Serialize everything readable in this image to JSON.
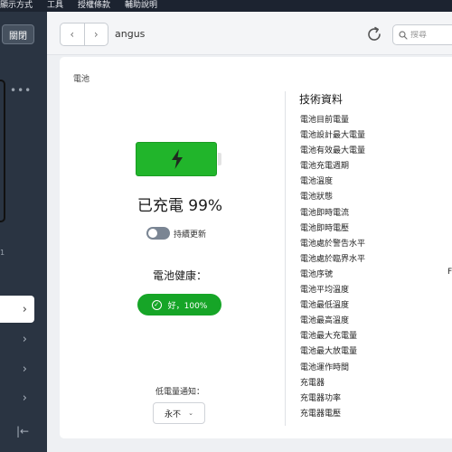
{
  "menu": [
    "顯示方式",
    "工具",
    "授權條款",
    "輔助說明"
  ],
  "sidebar": {
    "close_label": "關閉",
    "more_label": "•••",
    "number_label": "1",
    "items": [
      "›",
      "›",
      "›",
      "›"
    ],
    "collapse_label": "|←"
  },
  "toolbar": {
    "back": "‹",
    "forward": "›",
    "device_name": "angus",
    "search_placeholder": "搜尋"
  },
  "card": {
    "title": "電池",
    "battery": {
      "charged_text": "已充電 99%",
      "charge_level": 0.99,
      "auto_update_label": "持續更新",
      "auto_update_on": false,
      "health_label": "電池健康：",
      "health_value": "好，100%",
      "notify_label": "低電量通知：",
      "notify_value": "永不",
      "notify_chevron": "⌄",
      "check_glyph": "✓"
    },
    "specs": {
      "title": "技術資料",
      "items": [
        "電池目前電量",
        "電池設計最大電量",
        "電池有效最大電量",
        "電池充電週期",
        "電池溫度",
        "電池狀態",
        "電池即時電流",
        "電池即時電壓",
        "電池處於警告水平",
        "電池處於臨界水平",
        "電池序號",
        "電池平均溫度",
        "電池最低溫度",
        "電池最高溫度",
        "電池最大充電量",
        "電池最大放電量",
        "電池運作時間",
        "充電器",
        "充電器功率",
        "充電器電壓"
      ],
      "edge_char": "F"
    }
  },
  "colors": {
    "battery_green": "#21b52b",
    "health_green": "#16a527",
    "sidebar": "#2a3442",
    "menubar": "#1c2330"
  }
}
